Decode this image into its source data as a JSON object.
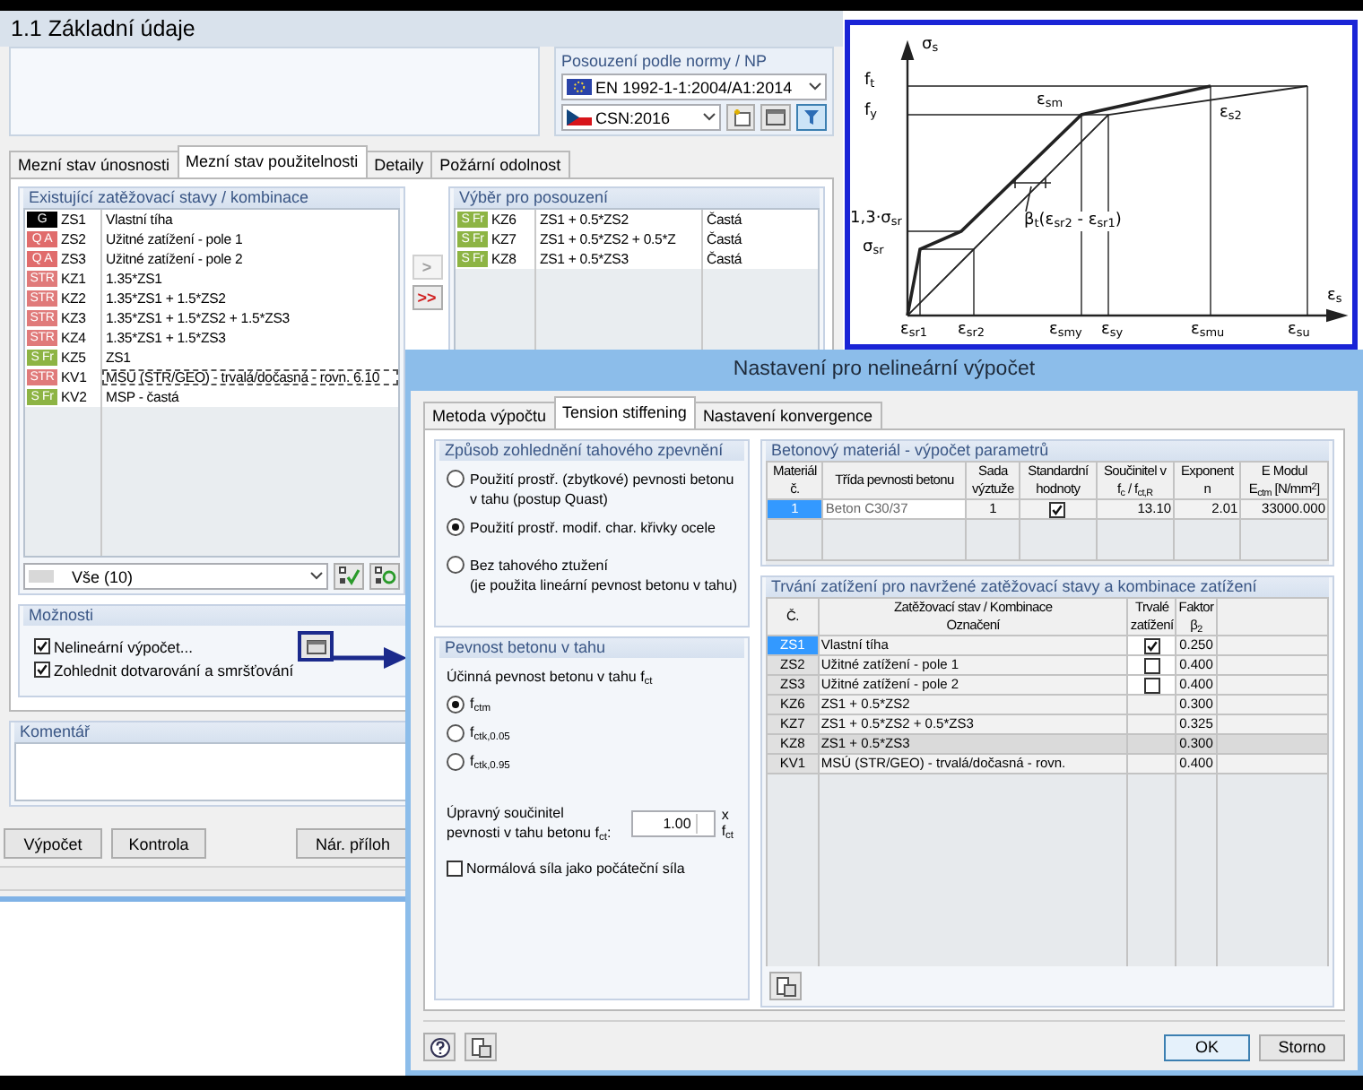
{
  "window": {
    "title": "1.1 Základní údaje"
  },
  "norm": {
    "heading": "Posouzení podle normy / NP",
    "standard": "EN 1992-1-1:2004/A1:2014",
    "annex": "CSN:2016"
  },
  "tabs": [
    {
      "label": "Mezní stav únosnosti",
      "selected": false
    },
    {
      "label": "Mezní stav použitelnosti",
      "selected": true
    },
    {
      "label": "Detaily",
      "selected": false
    },
    {
      "label": "Požární odolnost",
      "selected": false
    }
  ],
  "existing": {
    "heading": "Existující zatěžovací stavy /  kombinace",
    "filter": "Vše (10)",
    "rows": [
      {
        "tag": "G",
        "color": "#000000",
        "id": "ZS1",
        "name": "Vlastní tíha",
        "focused": false
      },
      {
        "tag": "Q A",
        "color": "#e06c6c",
        "id": "ZS2",
        "name": "Užitné zatížení  - pole 1",
        "focused": false
      },
      {
        "tag": "Q A",
        "color": "#e06c6c",
        "id": "ZS3",
        "name": "Užitné zatížení - pole 2",
        "focused": false
      },
      {
        "tag": "STR",
        "color": "#e07a7a",
        "id": "KZ1",
        "name": "1.35*ZS1",
        "focused": false
      },
      {
        "tag": "STR",
        "color": "#e07a7a",
        "id": "KZ2",
        "name": "1.35*ZS1 + 1.5*ZS2",
        "focused": false
      },
      {
        "tag": "STR",
        "color": "#e07a7a",
        "id": "KZ3",
        "name": "1.35*ZS1 + 1.5*ZS2 + 1.5*ZS3",
        "focused": false
      },
      {
        "tag": "STR",
        "color": "#e07a7a",
        "id": "KZ4",
        "name": "1.35*ZS1 + 1.5*ZS3",
        "focused": false
      },
      {
        "tag": "S Fr",
        "color": "#8db444",
        "id": "KZ5",
        "name": "ZS1",
        "focused": false
      },
      {
        "tag": "STR",
        "color": "#e07a7a",
        "id": "KV1",
        "name": "MSÚ (STR/GEO) - trvalá/dočasná - rovn. 6.10",
        "focused": true
      },
      {
        "tag": "S Fr",
        "color": "#8db444",
        "id": "KV2",
        "name": "MSP - častá",
        "focused": false
      }
    ]
  },
  "move_buttons": [
    {
      "label": ">",
      "disabled": true
    },
    {
      "label": ">>",
      "disabled": false
    }
  ],
  "selection": {
    "heading": "Výběr pro posouzení",
    "rows": [
      {
        "tag": "S Fr",
        "color": "#8db444",
        "id": "KZ6",
        "formula": "ZS1 + 0.5*ZS2",
        "type": "Častá"
      },
      {
        "tag": "S Fr",
        "color": "#8db444",
        "id": "KZ7",
        "formula": "ZS1 + 0.5*ZS2 + 0.5*Z",
        "type": "Častá"
      },
      {
        "tag": "S Fr",
        "color": "#8db444",
        "id": "KZ8",
        "formula": "ZS1 + 0.5*ZS3",
        "type": "Častá"
      }
    ]
  },
  "options": {
    "heading": "Možnosti",
    "items": [
      {
        "label": "Nelineární výpočet...",
        "checked": true
      },
      {
        "label": "Zohlednit dotvarování a smršťování",
        "checked": true
      }
    ]
  },
  "comment": {
    "heading": "Komentář"
  },
  "buttons": [
    "Výpočet",
    "Kontrola",
    "Nár. příloh"
  ],
  "diagram": {
    "labels": [
      "σ$_{s}$",
      "f$_{t}$",
      "f$_{y}$",
      "1,3·σ$_{sr}$",
      "σ$_{sr}$",
      "ε$_{sm}$",
      "ε$_{s2}$",
      "β$_{t}$(ε$_{sr2}$ - ε$_{sr1}$)",
      "ε$_{s}$",
      "ε$_{sr1}$",
      "ε$_{sr2}$",
      "ε$_{smy}$",
      "ε$_{sy}$",
      "ε$_{smu}$",
      "ε$_{su}$"
    ]
  },
  "dialog": {
    "title": "Nastavení pro nelineární výpočet",
    "tabs": [
      {
        "label": "Metoda výpočtu",
        "selected": false
      },
      {
        "label": "Tension stiffening",
        "selected": true
      },
      {
        "label": "Nastavení konvergence",
        "selected": false
      }
    ],
    "method": {
      "heading": "Způsob zohlednění tahového zpevnění",
      "options": [
        {
          "label": "Použití prostř. (zbytkové) pevnosti betonu v tahu (postup Quast)",
          "selected": false
        },
        {
          "label": "Použití prostř. modif. char. křivky ocele",
          "selected": true
        },
        {
          "label": "Bez tahového ztužení",
          "note": "(je použita lineární pevnost betonu v tahu)",
          "selected": false
        }
      ]
    },
    "strength": {
      "heading": "Pevnost betonu v tahu",
      "label": "Účinná pevnost betonu v tahu f$_{ct}$",
      "options": [
        {
          "label": "f$_{ctm}$",
          "selected": true
        },
        {
          "label": "f$_{ctk,0.05}$",
          "selected": false
        },
        {
          "label": "f$_{ctk,0.95}$",
          "selected": false
        }
      ],
      "factor_label": "Úpravný součinitel pevnosti v tahu betonu f$_{ct}$:",
      "factor_value": "1.00",
      "factor_unit": "x f$_{ct}$",
      "normal_force": {
        "label": "Normálová síla jako počáteční síla",
        "checked": false
      }
    },
    "material": {
      "heading": "Betonový materiál - výpočet parametrů",
      "columns": [
        [
          "Materiál",
          "č."
        ],
        [
          "Třída pevnosti betonu"
        ],
        [
          "Sada",
          "výztuže"
        ],
        [
          "Standardní",
          "hodnoty"
        ],
        [
          "Součinitel v",
          "f$_{c}$ / f$_{ct,R}$"
        ],
        [
          "Exponent",
          "n"
        ],
        [
          "E Modul",
          "E$_{ctm}$ [N/mm$^{2}$]"
        ]
      ],
      "rows": [
        {
          "no": "1",
          "selected": true,
          "class": "Beton C30/37",
          "set": "1",
          "standard": true,
          "coefficient": "13.10",
          "exponent": "2.01",
          "modulus": "33000.000"
        }
      ]
    },
    "duration": {
      "heading": "Trvání zatížení pro navržené zatěžovací stavy a kombinace zatížení",
      "columns": [
        [
          "Č."
        ],
        [
          "Zatěžovací stav / Kombinace",
          "Označení"
        ],
        [
          "Trvalé",
          "zatížení"
        ],
        [
          "Faktor",
          "β$_{2}$"
        ]
      ],
      "rows": [
        {
          "id": "ZS1",
          "name": "Vlastní tíha",
          "kind": "case",
          "permanent": true,
          "factor": "0.250",
          "selected": true,
          "hovered": false
        },
        {
          "id": "ZS2",
          "name": "Užitné zatížení  - pole 1",
          "kind": "case",
          "permanent": false,
          "factor": "0.400",
          "selected": false,
          "hovered": false
        },
        {
          "id": "ZS3",
          "name": "Užitné zatížení - pole 2",
          "kind": "case",
          "permanent": false,
          "factor": "0.400",
          "selected": false,
          "hovered": false
        },
        {
          "id": "KZ6",
          "name": "ZS1 + 0.5*ZS2",
          "kind": "combination",
          "factor": "0.300",
          "selected": false,
          "hovered": false
        },
        {
          "id": "KZ7",
          "name": "ZS1 + 0.5*ZS2 + 0.5*ZS3",
          "kind": "combination",
          "factor": "0.325",
          "selected": false,
          "hovered": false
        },
        {
          "id": "KZ8",
          "name": "ZS1 + 0.5*ZS3",
          "kind": "combination",
          "factor": "0.300",
          "selected": false,
          "hovered": true
        },
        {
          "id": "KV1",
          "name": "MSÚ (STR/GEO) - trvalá/dočasná - rovn.",
          "kind": "combination",
          "factor": "0.400",
          "selected": false,
          "hovered": false
        }
      ]
    },
    "buttons": [
      "OK",
      "Storno"
    ]
  }
}
